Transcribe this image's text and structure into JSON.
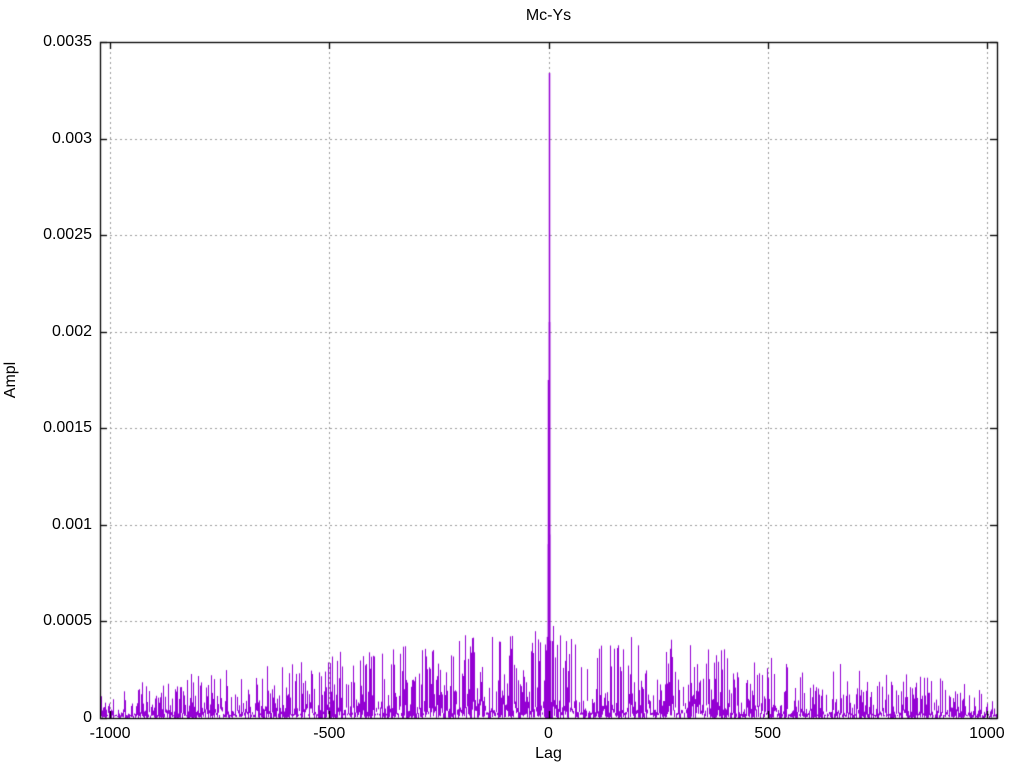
{
  "chart": {
    "title": "Mc-Ys",
    "xlabel": "Lag",
    "ylabel": "Ampl"
  },
  "colors": {
    "line": "#9400d3",
    "grid": "#9c9c9c",
    "axis": "#000000",
    "text": "#000000",
    "background": "#ffffff"
  },
  "chart_data": {
    "type": "line",
    "title": "Mc-Ys",
    "xlabel": "Lag",
    "ylabel": "Ampl",
    "x_range": [
      -1023,
      1023
    ],
    "y_range": [
      0,
      0.0035
    ],
    "x_ticks": [
      -1000,
      -500,
      0,
      500,
      1000
    ],
    "x_tick_labels": [
      "-1000",
      "-500",
      "0",
      "500",
      "1000"
    ],
    "y_ticks": [
      0,
      0.0005,
      0.001,
      0.0015,
      0.002,
      0.0025,
      0.003,
      0.0035
    ],
    "y_tick_labels": [
      "0",
      "0.0005",
      "0.001",
      "0.0015",
      "0.002",
      "0.0025",
      "0.003",
      "0.0035"
    ],
    "grid": true,
    "legend": "none",
    "series": [
      {
        "name": "Mc-Ys",
        "color": "#9400d3",
        "style": "dense impulse-like correlation trace",
        "peak_points": [
          {
            "lag": -5,
            "ampl": 0.00035
          },
          {
            "lag": -3,
            "ampl": 0.00042
          },
          {
            "lag": -2,
            "ampl": 0.0009
          },
          {
            "lag": -1,
            "ampl": 0.00175
          },
          {
            "lag": 0,
            "ampl": 0.00334
          },
          {
            "lag": 1,
            "ampl": 0.00205
          },
          {
            "lag": 2,
            "ampl": 0.00095
          },
          {
            "lag": 4,
            "ampl": 0.0004
          }
        ],
        "noise_envelope": {
          "shape": "triangular",
          "edge_max_ampl": 8e-05,
          "center_max_ampl": 0.00024,
          "seed": 1337
        }
      }
    ]
  }
}
